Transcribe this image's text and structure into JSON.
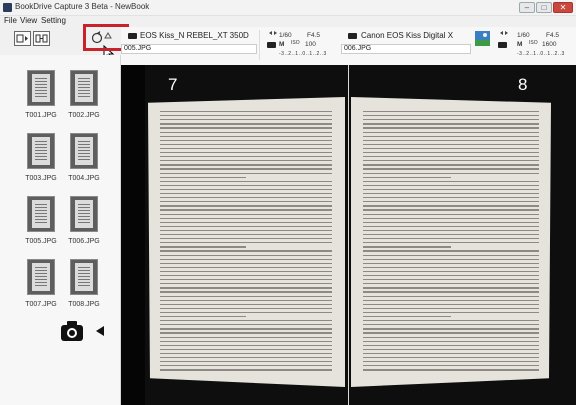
{
  "window": {
    "title": "BookDrive Capture 3 Beta - NewBook",
    "buttons": {
      "minimize": "–",
      "maximize": "□",
      "close": "✕"
    }
  },
  "menu": {
    "items": [
      "File",
      "View",
      "Setting"
    ]
  },
  "cameras": [
    {
      "name": "EOS Kiss_N REBEL_XT 350D",
      "file": "005.JPG",
      "settings": {
        "shutter": "1/60",
        "aperture": "F4.5",
        "mode": "M",
        "iso_label": "ISO",
        "iso": "100",
        "ev": "-3..2..1..0..1..2..3"
      }
    },
    {
      "name": "Canon EOS Kiss Digital X",
      "file": "006.JPG",
      "settings": {
        "shutter": "1/60",
        "aperture": "F4.5",
        "mode": "M",
        "iso_label": "ISO",
        "iso": "1600",
        "ev": "-3..2..1..0..1..2..3"
      }
    }
  ],
  "thumbnails": [
    "T001.JPG",
    "T002.JPG",
    "T003.JPG",
    "T004.JPG",
    "T005.JPG",
    "T006.JPG",
    "T007.JPG",
    "T008.JPG"
  ],
  "viewer": {
    "left_page_number": "7",
    "right_page_number": "8"
  },
  "colors": {
    "highlight": "#c7232a",
    "viewer_bg": "#0e0e0e"
  }
}
